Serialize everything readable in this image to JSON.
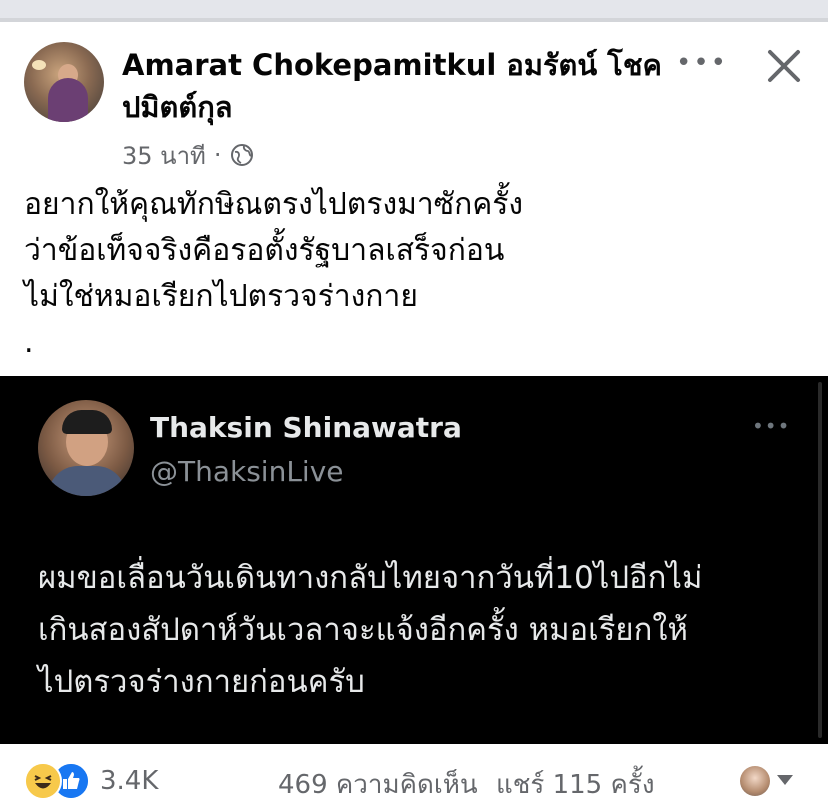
{
  "post": {
    "author": "Amarat Chokepamitkul อมรัตน์ โชค ปมิตต์กุล",
    "time": "35 นาที",
    "separator": "·",
    "text_lines": [
      "อยากให้คุณทักษิณตรงไปตรงมาซักครั้ง",
      "ว่าข้อเท็จจริงคือรอตั้งรัฐบาลเสร็จก่อน",
      "ไม่ใช่หมอเรียกไปตรวจร่างกาย",
      "."
    ]
  },
  "embed": {
    "name": "Thaksin Shinawatra",
    "handle": "@ThaksinLive",
    "text_lines": [
      "ผมขอเลื่อนวันเดินทางกลับไทยจากวันที่10ไปอีกไม่",
      "เกินสองสัปดาห์วันเวลาจะแจ้งอีกครั้ง หมอเรียกให้",
      "ไปตรวจร่างกายก่อนครับ"
    ]
  },
  "footer": {
    "reaction_count": "3.4K",
    "comments": "469 ความคิดเห็น",
    "shares": "แชร์ 115 ครั้ง"
  },
  "icons": {
    "more": "more-options-icon",
    "close": "close-icon",
    "privacy": "globe-icon",
    "reactions": [
      "haha-reaction-icon",
      "like-reaction-icon"
    ]
  },
  "colors": {
    "secondary_text": "#65676b",
    "embed_background": "#000000",
    "like_blue": "#1877f2",
    "haha_yellow": "#f7c94b"
  }
}
